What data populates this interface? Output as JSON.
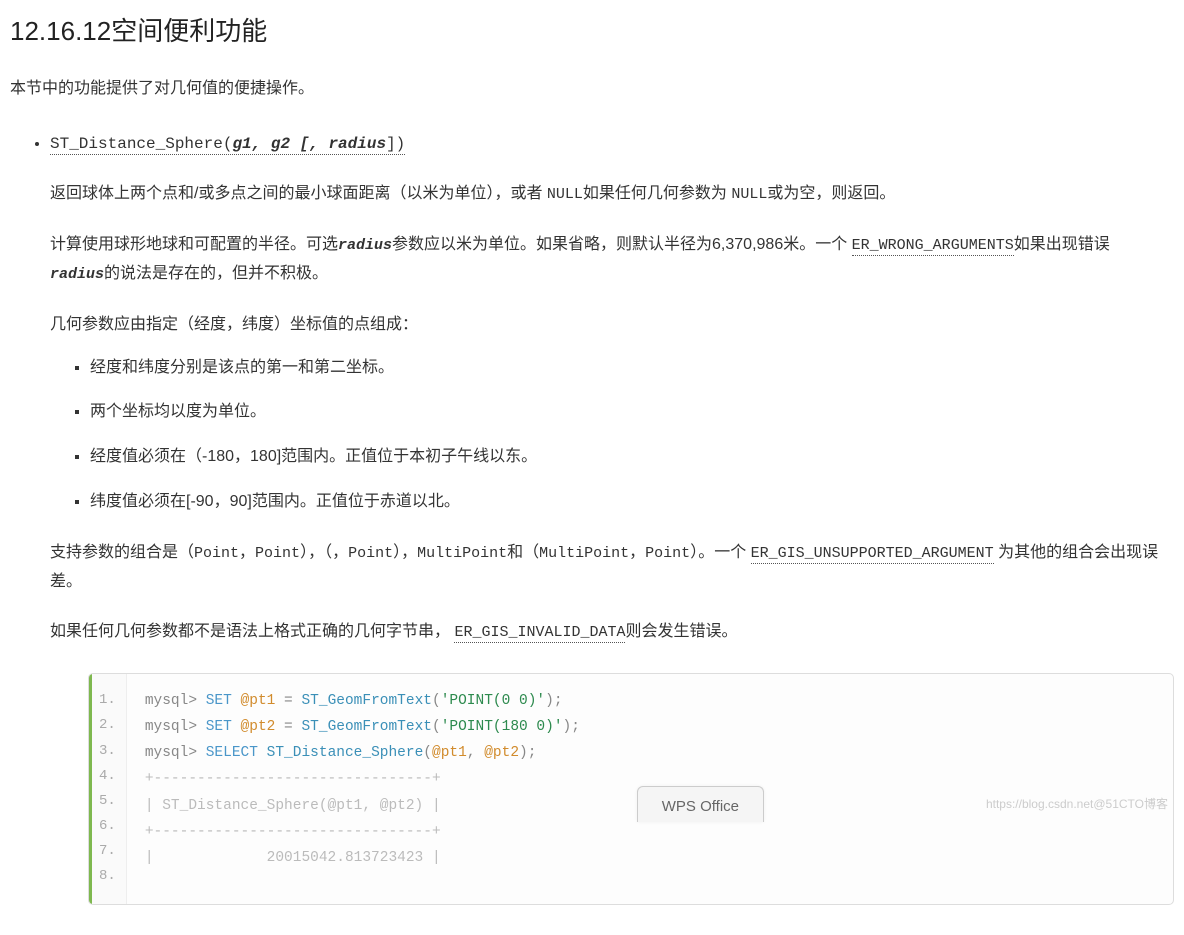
{
  "heading": {
    "number": "12.16.12",
    "title": "空间便利功能"
  },
  "intro": "本节中的功能提供了对几何值的便捷操作。",
  "func": {
    "name": "ST_Distance_Sphere",
    "args_html": "(g1, g2 [, radius])",
    "arg_g1": "g1",
    "arg_sep1": ", ",
    "arg_g2": "g2",
    "arg_open": " [, ",
    "arg_radius": "radius",
    "arg_close": "])"
  },
  "p1_a": "返回球体上两个点和/或多点之间的最小球面距离（以米为单位），或者 ",
  "p1_null1": "NULL",
  "p1_b": "如果任何几何参数为 ",
  "p1_null2": "NULL",
  "p1_c": "或为空，则返回。",
  "p2_a": "计算使用球形地球和可配置的半径。可选",
  "p2_radius1": "radius",
  "p2_b": "参数应以米为单位。如果省略，则默认半径为6,370,986米。一个 ",
  "p2_err": "ER_WRONG_ARGUMENTS",
  "p2_c": "如果出现错误",
  "p2_radius2": "radius",
  "p2_d": "的说法是存在的，但并不积极。",
  "p3": "几何参数应由指定（经度，纬度）坐标值的点组成：",
  "inner": [
    "经度和纬度分别是该点的第一和第二坐标。",
    "两个坐标均以度为单位。",
    "经度值必须在（-180，180]范围内。正值位于本初子午线以东。",
    "纬度值必须在[-90，90]范围内。正值位于赤道以北。"
  ],
  "p4_a": "支持参数的组合是（",
  "p4_m1": "Point",
  "p4_s1": "，",
  "p4_m2": "Point",
  "p4_s2": "），（，",
  "p4_m3": "Point",
  "p4_s3": "），",
  "p4_m4": "MultiPoint",
  "p4_s4": "和（",
  "p4_m5": "MultiPoint",
  "p4_s5": "，",
  "p4_m6": "Point",
  "p4_s6": "）。一个 ",
  "p4_err": "ER_GIS_UNSUPPORTED_ARGUMENT",
  "p4_b": " 为其他的组合会出现误差。",
  "p5_a": "如果任何几何参数都不是语法上格式正确的几何字节串， ",
  "p5_err": "ER_GIS_INVALID_DATA",
  "p5_b": "则会发生错误。",
  "code": {
    "gutter": [
      "1",
      "2",
      "3",
      "4",
      "5",
      "6",
      "7",
      "8"
    ],
    "lines": [
      {
        "type": "sql",
        "prompt": "mysql> ",
        "kw": "SET",
        "sp": " ",
        "var": "@pt1",
        "eq": " = ",
        "fn": "ST_GeomFromText",
        "open": "(",
        "str": "'POINT(0 0)'",
        "close": ");"
      },
      {
        "type": "sql",
        "prompt": "mysql> ",
        "kw": "SET",
        "sp": " ",
        "var": "@pt2",
        "eq": " = ",
        "fn": "ST_GeomFromText",
        "open": "(",
        "str": "'POINT(180 0)'",
        "close": ");"
      },
      {
        "type": "sel",
        "prompt": "mysql> ",
        "kw": "SELECT",
        "sp": " ",
        "fn": "ST_Distance_Sphere",
        "open": "(",
        "var1": "@pt1",
        "comma": ", ",
        "var2": "@pt2",
        "close": ");"
      },
      {
        "type": "plain",
        "text": "+--------------------------------+"
      },
      {
        "type": "plain",
        "text": "| ST_Distance_Sphere(@pt1, @pt2) |"
      },
      {
        "type": "plain",
        "text": "+--------------------------------+"
      },
      {
        "type": "plain",
        "text": "|             20015042.813723423 |"
      }
    ]
  },
  "wps": "WPS Office",
  "watermark": "https://blog.csdn.net@51CTO博客"
}
